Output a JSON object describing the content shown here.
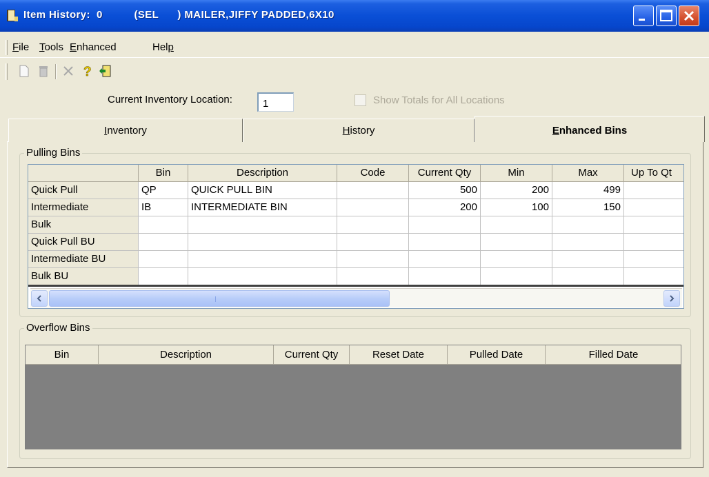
{
  "window": {
    "title_label": "Item History:",
    "title_number": "0",
    "title_code": "(SEL",
    "title_desc": ") MAILER,JIFFY PADDED,6X10",
    "icon": "book-icon",
    "controls": [
      "minimize-icon",
      "maximize-icon",
      "close-icon"
    ]
  },
  "menu": {
    "items": [
      {
        "label": "File",
        "underline": "F",
        "rest": "ile"
      },
      {
        "label": "Tools",
        "underline": "T",
        "rest": "ools"
      },
      {
        "label": "Enhanced",
        "underline": "E",
        "rest": "nhanced"
      },
      {
        "label": "Help",
        "pre": "Hel",
        "underline": "p"
      }
    ]
  },
  "toolbar": {
    "icons": [
      "new-document-icon",
      "delete-icon",
      "cancel-icon",
      "help-icon",
      "exit-icon"
    ]
  },
  "location": {
    "label": "Current Inventory Location:",
    "value": "1",
    "show_totals_label": "Show Totals for All Locations",
    "show_totals_checked": false
  },
  "tabs": [
    {
      "label": "Inventory",
      "underline": "I",
      "rest": "nventory",
      "active": false
    },
    {
      "label": "History",
      "underline": "H",
      "rest": "istory",
      "active": false
    },
    {
      "label": "Enhanced Bins",
      "underline": "E",
      "rest": "nhanced Bins",
      "active": true
    }
  ],
  "pulling_bins": {
    "title": "Pulling Bins",
    "columns": [
      "Bin",
      "Description",
      "Code",
      "Current Qty",
      "Min",
      "Max",
      "Up To Qt"
    ],
    "rows": [
      {
        "label": "Quick Pull",
        "bin": "QP",
        "description": "QUICK PULL BIN",
        "code": "",
        "current_qty": "500",
        "min": "200",
        "max": "499",
        "up_to": ""
      },
      {
        "label": "Intermediate",
        "bin": "IB",
        "description": "INTERMEDIATE BIN",
        "code": "",
        "current_qty": "200",
        "min": "100",
        "max": "150",
        "up_to": ""
      },
      {
        "label": "Bulk",
        "bin": "",
        "description": "",
        "code": "",
        "current_qty": "",
        "min": "",
        "max": "",
        "up_to": ""
      },
      {
        "label": "Quick Pull BU",
        "bin": "",
        "description": "",
        "code": "",
        "current_qty": "",
        "min": "",
        "max": "",
        "up_to": ""
      },
      {
        "label": "Intermediate BU",
        "bin": "",
        "description": "",
        "code": "",
        "current_qty": "",
        "min": "",
        "max": "",
        "up_to": ""
      },
      {
        "label": "Bulk BU",
        "bin": "",
        "description": "",
        "code": "",
        "current_qty": "",
        "min": "",
        "max": "",
        "up_to": ""
      }
    ]
  },
  "overflow_bins": {
    "title": "Overflow Bins",
    "columns": [
      "Bin",
      "Description",
      "Current Qty",
      "Reset Date",
      "Pulled Date",
      "Filled Date"
    ]
  }
}
